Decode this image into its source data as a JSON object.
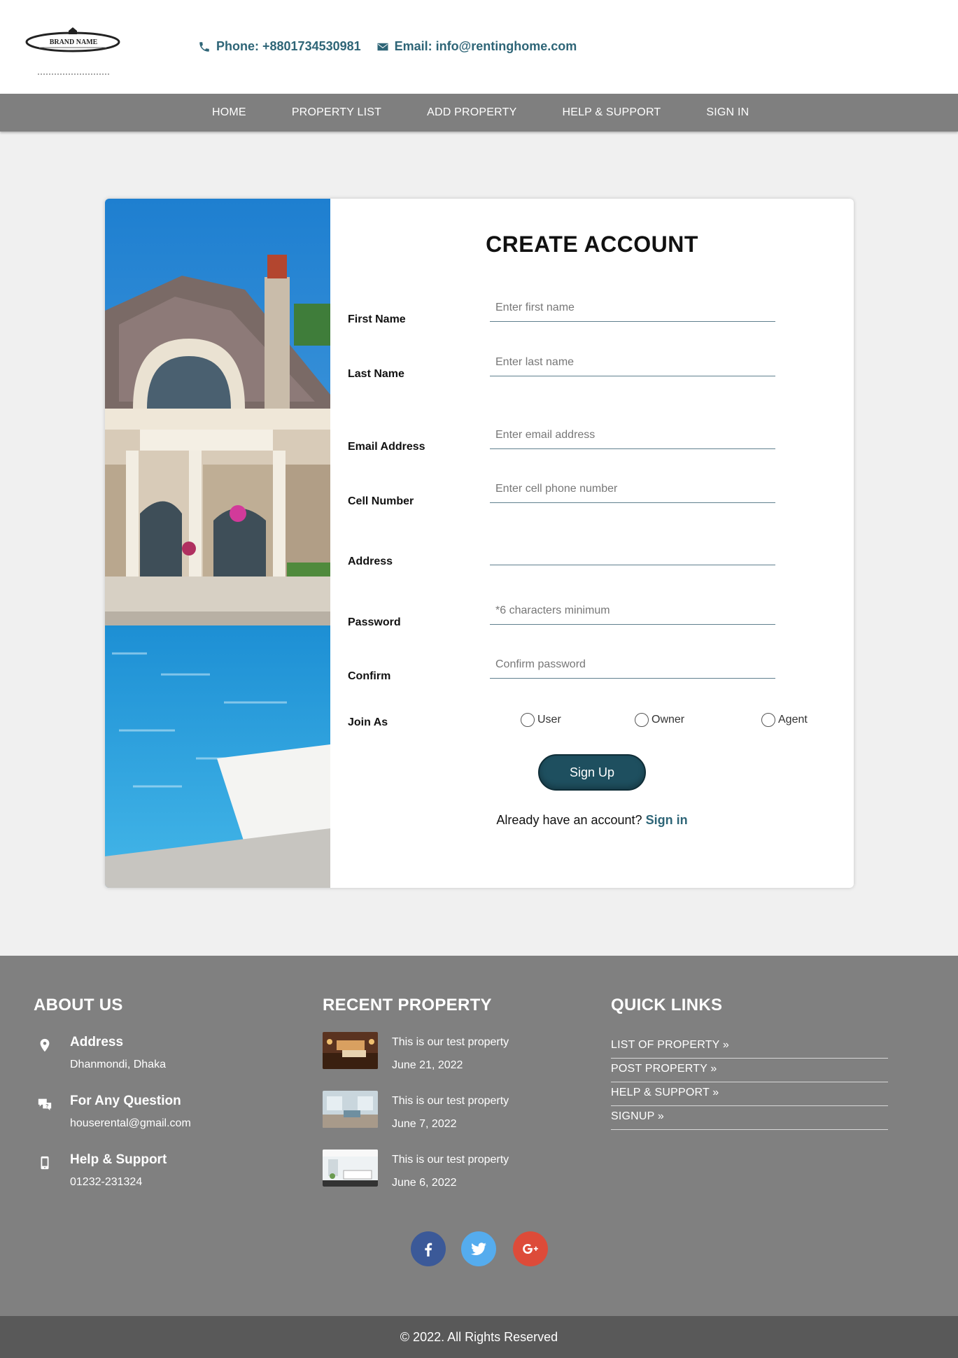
{
  "header": {
    "logo_text": "BRAND NAME",
    "phone": "Phone: +8801734530981",
    "email": "Email: info@rentinghome.com"
  },
  "nav": {
    "items": [
      "HOME",
      "PROPERTY LIST",
      "ADD PROPERTY",
      "HELP & SUPPORT",
      "SIGN IN"
    ]
  },
  "form": {
    "title": "CREATE ACCOUNT",
    "fields": [
      {
        "label": "First Name",
        "placeholder": "Enter first name"
      },
      {
        "label": "Last Name",
        "placeholder": "Enter last name"
      },
      {
        "label": "Email Address",
        "placeholder": "Enter email address"
      },
      {
        "label": "Cell Number",
        "placeholder": "Enter cell phone number"
      },
      {
        "label": "Address",
        "placeholder": ""
      },
      {
        "label": "Password",
        "placeholder": "*6 characters minimum"
      },
      {
        "label": "Confirm",
        "placeholder": "Confirm password"
      }
    ],
    "join_label": "Join As",
    "roles": [
      "User",
      "Owner",
      "Agent"
    ],
    "submit_label": "Sign Up",
    "already_text": "Already have an account?",
    "signin_link": "Sign in"
  },
  "footer": {
    "about": {
      "title": "ABOUT US",
      "items": [
        {
          "icon": "location-pin-icon",
          "title": "Address",
          "value": "Dhanmondi, Dhaka"
        },
        {
          "icon": "question-chat-icon",
          "title": "For Any Question",
          "value": "houserental@gmail.com"
        },
        {
          "icon": "mobile-phone-icon",
          "title": "Help & Support",
          "value": "01232-231324"
        }
      ]
    },
    "recent": {
      "title": "RECENT PROPERTY",
      "items": [
        {
          "title": "This is our test property",
          "date": "June 21, 2022"
        },
        {
          "title": "This is our test property",
          "date": "June 7, 2022"
        },
        {
          "title": "This is our test property",
          "date": "June 6, 2022"
        }
      ]
    },
    "quick_links": {
      "title": "QUICK LINKS",
      "items": [
        "LIST OF PROPERTY »",
        "POST PROPERTY »",
        "HELP & SUPPORT »",
        "SIGNUP »"
      ]
    },
    "social": [
      {
        "icon": "facebook-icon",
        "color": "#3b5998"
      },
      {
        "icon": "twitter-icon",
        "color": "#55acee"
      },
      {
        "icon": "google-plus-icon",
        "color": "#dd4b39"
      }
    ],
    "copyright": "© 2022. All Rights Reserved"
  },
  "colors": {
    "accent": "#2e6577",
    "nav_bg": "#7f7f7f",
    "footer_bg": "#808080",
    "button_bg": "#1e4f5f"
  }
}
